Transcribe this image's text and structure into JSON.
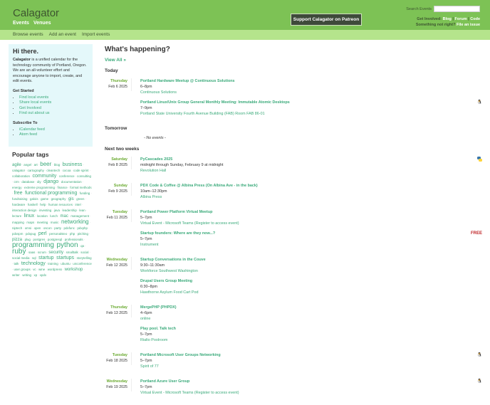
{
  "header": {
    "logo": "Calagator",
    "nav": [
      "Events",
      "Venues"
    ],
    "patreon": "Support Calagator on Patreon",
    "search_label": "Search Events",
    "search_value": "",
    "get_involved": "Get Involved:",
    "links": [
      "Blog",
      "Forum",
      "Code"
    ],
    "wrong": "Something not right?",
    "file_issue": "File an issue"
  },
  "subnav": [
    "Browse events",
    "Add an event",
    "Import events"
  ],
  "intro": {
    "title": "Hi there.",
    "brand": "Calagator",
    "text": " is a unified calendar for the technology community of Portland, Oregon. We are an all-volunteer effort and encourage anyone to import, create, and edit events.",
    "get_started": "Get Started",
    "gs_links": [
      "Find local events",
      "Share local events",
      "Get Involved",
      "Find out about us"
    ],
    "subscribe": "Subscribe To",
    "sub_links": [
      "iCalendar feed",
      "Atom feed"
    ]
  },
  "tags": {
    "title": "Popular tags",
    "items": [
      [
        "agile",
        2
      ],
      [
        "angel",
        1
      ],
      [
        "art",
        1
      ],
      [
        "beer",
        4
      ],
      [
        "blog",
        1
      ],
      [
        "business",
        3
      ],
      [
        "calagator",
        1
      ],
      [
        "cartography",
        1
      ],
      [
        "cleantech",
        1
      ],
      [
        "cocoa",
        1
      ],
      [
        "code sprint",
        1
      ],
      [
        "collaboration",
        1
      ],
      [
        "community",
        3
      ],
      [
        "conference",
        1
      ],
      [
        "consulting",
        1
      ],
      [
        "crm",
        1
      ],
      [
        "database",
        1
      ],
      [
        "diy",
        1
      ],
      [
        "django",
        3
      ],
      [
        "documentation",
        1
      ],
      [
        "energy",
        1
      ],
      [
        "extreme programming",
        1
      ],
      [
        "finance",
        1
      ],
      [
        "formal methods",
        1
      ],
      [
        "free",
        3
      ],
      [
        "functional programming",
        3
      ],
      [
        "funding",
        1
      ],
      [
        "fundraising",
        1
      ],
      [
        "galois",
        1
      ],
      [
        "game",
        1
      ],
      [
        "geography",
        1
      ],
      [
        "gis",
        2
      ],
      [
        "green",
        1
      ],
      [
        "hardware",
        1
      ],
      [
        "haskell",
        1
      ],
      [
        "help",
        1
      ],
      [
        "human resources",
        1
      ],
      [
        "intel",
        1
      ],
      [
        "interaction design",
        1
      ],
      [
        "investing",
        1
      ],
      [
        "java",
        1
      ],
      [
        "leadership",
        1
      ],
      [
        "lean",
        1
      ],
      [
        "lecture",
        1
      ],
      [
        "linux",
        3
      ],
      [
        "location",
        1
      ],
      [
        "lunch",
        1
      ],
      [
        "mac",
        2
      ],
      [
        "management",
        1
      ],
      [
        "mapping",
        1
      ],
      [
        "maps",
        1
      ],
      [
        "meeting",
        1
      ],
      [
        "music",
        1
      ],
      [
        "networking",
        4
      ],
      [
        "niptech",
        1
      ],
      [
        "omsi",
        1
      ],
      [
        "open",
        1
      ],
      [
        "oscon",
        1
      ],
      [
        "party",
        1
      ],
      [
        "pdxfunc",
        1
      ],
      [
        "pdxphp",
        1
      ],
      [
        "pdxspm",
        1
      ],
      [
        "pdxpug",
        1
      ],
      [
        "perl",
        3
      ],
      [
        "personalsteo",
        1
      ],
      [
        "php",
        1
      ],
      [
        "pitching",
        1
      ],
      [
        "pizza",
        2
      ],
      [
        "plug",
        1
      ],
      [
        "postgres",
        1
      ],
      [
        "postgresql",
        1
      ],
      [
        "professionals",
        1
      ],
      [
        "programming",
        5
      ],
      [
        "python",
        5
      ],
      [
        "qa",
        1
      ],
      [
        "ruby",
        5
      ],
      [
        "saas",
        1
      ],
      [
        "scrum",
        1
      ],
      [
        "security",
        2
      ],
      [
        "smalltalk",
        1
      ],
      [
        "social",
        1
      ],
      [
        "social media",
        1
      ],
      [
        "sql",
        1
      ],
      [
        "startup",
        3
      ],
      [
        "startups",
        3
      ],
      [
        "storytelling",
        1
      ],
      [
        "talk",
        1
      ],
      [
        "technology",
        3
      ],
      [
        "training",
        1
      ],
      [
        "ubuntu",
        1
      ],
      [
        "unconference",
        1
      ],
      [
        "user groups",
        1
      ],
      [
        "vc",
        1
      ],
      [
        "wine",
        1
      ],
      [
        "wordpress",
        1
      ],
      [
        "workshop",
        2
      ],
      [
        "writer",
        1
      ],
      [
        "writing",
        1
      ],
      [
        "xp",
        1
      ],
      [
        "xpdx",
        1
      ]
    ]
  },
  "main": {
    "title": "What's happening?",
    "view_all": "View All »",
    "today": "Today",
    "tomorrow": "Tomorrow",
    "no_events": "- No events -",
    "next": "Next two weeks",
    "today_days": [
      {
        "dow": "Thursday",
        "date": "Feb 6 2025",
        "events": [
          {
            "title": "Portland Hardware Meetup @ Continuous Solutions",
            "time": "6–8pm",
            "venue": "Continuous Solutions"
          },
          {
            "title": "Portland Linux/Unix Group General Monthly Meeting: Immutable Atomic Desktops",
            "time": "7–9pm",
            "venue": "Portland State University Fourth Avenue Building (FAB) Room FAB 86-01",
            "badge": "linux"
          }
        ]
      }
    ],
    "next_days": [
      {
        "dow": "Saturday",
        "date": "Feb 8 2025",
        "events": [
          {
            "title": "PyCascades 2025",
            "time": "midnight through Sunday, February 9 at midnight",
            "venue": "Revolution Hall",
            "badge": "python"
          }
        ]
      },
      {
        "dow": "Sunday",
        "date": "Feb 9 2025",
        "events": [
          {
            "title": "PDX Code & Coffee @ Albina Press (On Albina Ave - in the back)",
            "time": "10am–12:30pm",
            "venue": "Albina Press"
          }
        ]
      },
      {
        "dow": "Tuesday",
        "date": "Feb 11 2025",
        "events": [
          {
            "title": "Portland Power Platform Virtual Meetup",
            "time": "5–7pm",
            "venue": "Virtual Event - Microsoft Teams (Register to access event)"
          },
          {
            "title": "Startup founders: Where are they now...?",
            "time": "5–7pm",
            "venue": "Instrument",
            "badge": "free"
          }
        ]
      },
      {
        "dow": "Wednesday",
        "date": "Feb 12 2025",
        "events": [
          {
            "title": "Startup Conversations in the Couve",
            "time": "9:30–11:30am",
            "venue": "Workforce Southwest Washington"
          },
          {
            "title": "Drupal Users Group Meeting",
            "time": "6:30–8pm",
            "venue": "Hawthorne Asylum Food Cart Pod"
          }
        ]
      },
      {
        "dow": "Thursday",
        "date": "Feb 13 2025",
        "events": [
          {
            "title": "MergePHP (PHPDX)",
            "time": "4–6pm",
            "venue": "online"
          },
          {
            "title": "Play pool. Talk tech",
            "time": "5–7pm",
            "venue": "Rialto Poolroom"
          }
        ]
      },
      {
        "dow": "Tuesday",
        "date": "Feb 18 2025",
        "events": [
          {
            "title": "Portland Microsoft User Groups Networking",
            "time": "5–7pm",
            "venue": "Spirit of 77",
            "badge": "linux"
          }
        ]
      },
      {
        "dow": "Wednesday",
        "date": "Feb 19 2025",
        "events": [
          {
            "title": "Portland Azure User Group",
            "time": "5–7pm",
            "venue": "Virtual Event - Microsoft Teams (Register to access event)",
            "badge": "linux"
          }
        ]
      }
    ]
  },
  "badges": {
    "free": "FREE"
  }
}
